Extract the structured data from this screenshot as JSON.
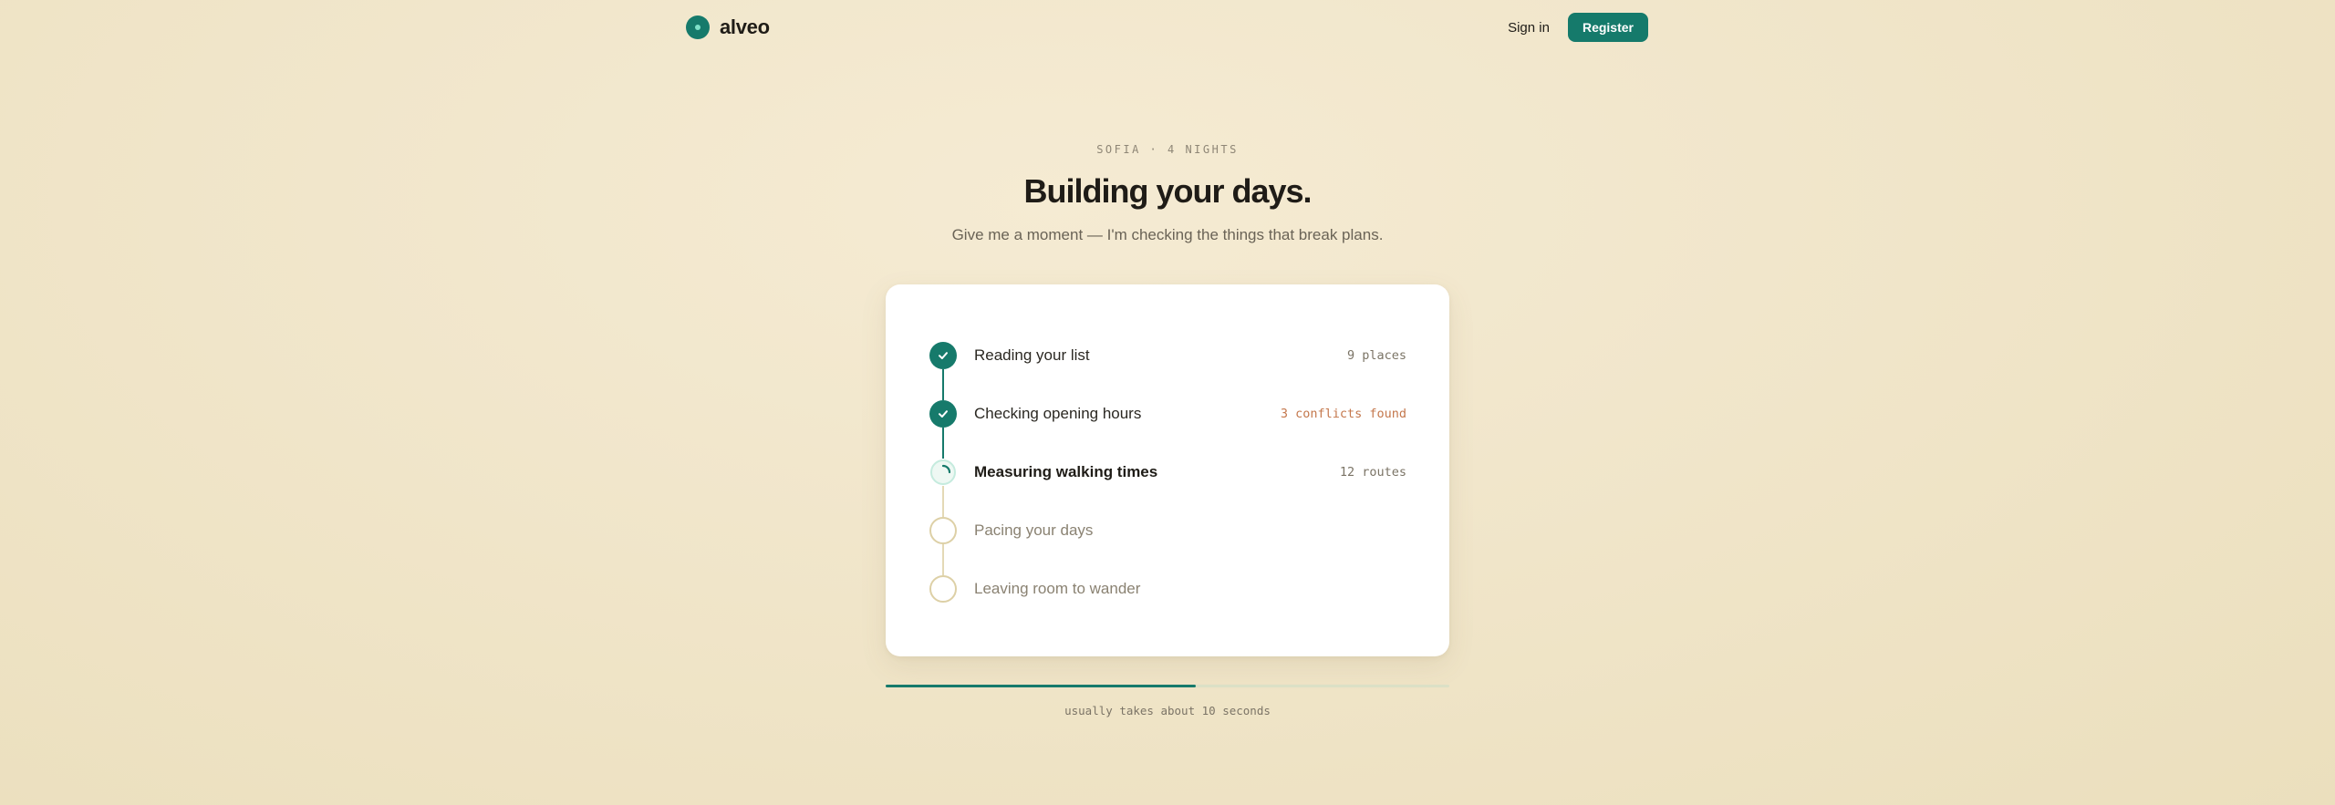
{
  "nav": {
    "brand": "alveo",
    "sign_in": "Sign in",
    "register": "Register"
  },
  "hero": {
    "eyebrow": "SOFIA · 4 NIGHTS",
    "title": "Building your days.",
    "subtitle": "Give me a moment — I'm checking the things that break plans."
  },
  "steps": [
    {
      "label": "Reading your list",
      "meta": "9 places",
      "status": "done"
    },
    {
      "label": "Checking opening hours",
      "meta": "3 conflicts found",
      "status": "done"
    },
    {
      "label": "Measuring walking times",
      "meta": "12 routes",
      "status": "active"
    },
    {
      "label": "Pacing your days",
      "meta": "",
      "status": "pending"
    },
    {
      "label": "Leaving room to wander",
      "meta": "",
      "status": "pending"
    }
  ],
  "progress": {
    "fraction": 0.55,
    "note": "usually takes about 10 seconds"
  },
  "colors": {
    "accent": "#167a6b",
    "warning": "#c4774c",
    "pending": "#ddd0a6"
  }
}
